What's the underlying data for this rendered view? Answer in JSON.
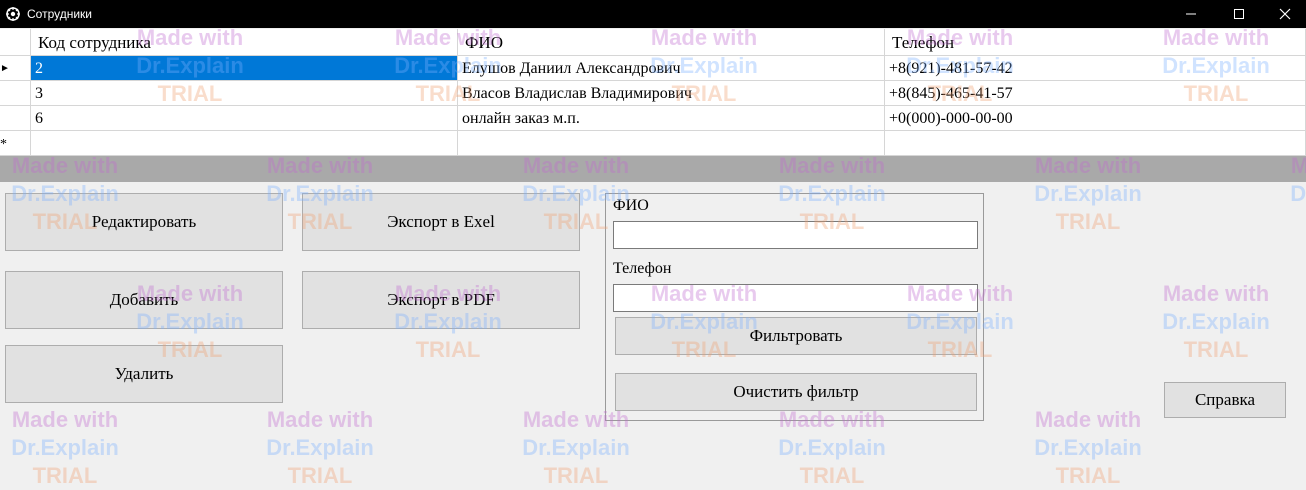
{
  "window": {
    "title": "Сотрудники",
    "minimize_icon": "minimize-icon",
    "maximize_icon": "maximize-icon",
    "close_icon": "close-icon"
  },
  "grid": {
    "columns": [
      "Код сотрудника",
      "ФИО",
      "Телефон"
    ],
    "rows": [
      {
        "id": "2",
        "name": "Елушов Даниил Александрович",
        "phone": "+8(921)-481-57-42",
        "selected": true
      },
      {
        "id": "3",
        "name": "Власов Владислав Владимирович",
        "phone": "+8(845)-465-41-57",
        "selected": false
      },
      {
        "id": "6",
        "name": "онлайн заказ м.п.",
        "phone": "+0(000)-000-00-00",
        "selected": false
      }
    ],
    "current_row_marker": "►",
    "new_row_marker": "*"
  },
  "buttons": {
    "edit": "Редактировать",
    "add": "Добавить",
    "delete": "Удалить",
    "export_excel": "Экспорт в Exel",
    "export_pdf": "Экспорт в PDF",
    "filter": "Фильтровать",
    "clear_filter": "Очистить фильтр",
    "help": "Справка"
  },
  "filter": {
    "fio_label": "ФИО",
    "fio_value": "",
    "phone_label": "Телефон",
    "phone_value": ""
  },
  "watermark": {
    "line1": "Made with",
    "line2": "Dr.Explain",
    "line3": "TRIAL"
  }
}
